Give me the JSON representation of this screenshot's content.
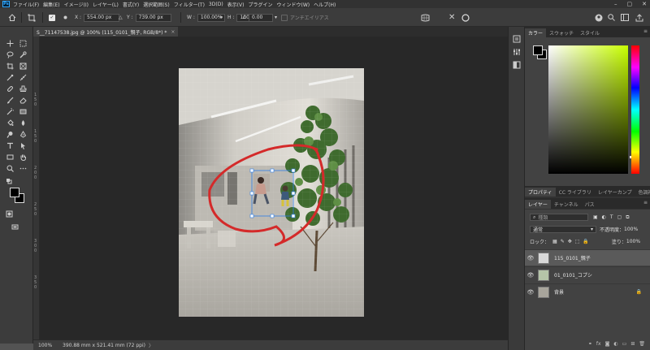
{
  "menubar": {
    "items": [
      "ファイル(F)",
      "編集(E)",
      "イメージ(I)",
      "レイヤー(L)",
      "書式(Y)",
      "選択範囲(S)",
      "フィルター(T)",
      "3D(D)",
      "表示(V)",
      "プラグイン",
      "ウィンドウ(W)",
      "ヘルプ(H)"
    ]
  },
  "options": {
    "x_label": "X :",
    "x_value": "554.00 px",
    "y_label": "Y :",
    "y_value": "739.00 px",
    "w_label": "W :",
    "w_value": "100.00%",
    "h_label": "H :",
    "h_value": "100.00%",
    "angle_value": "0.00",
    "antialias_label": "アンチエイリアス"
  },
  "document": {
    "tab_title": "S__71147538.jpg @ 100% (115_0101_親子, RGB/8*) *",
    "tab_close": "×"
  },
  "ruler": {
    "vertical_ticks": [
      "1",
      "5",
      "0",
      "1",
      "5",
      "0",
      "2",
      "0",
      "0",
      "2",
      "5",
      "0",
      "3",
      "0",
      "0",
      "3",
      "5",
      "0"
    ]
  },
  "status": {
    "zoom": "100%",
    "dimensions": "390.88 mm x 521.41 mm (72 ppi)",
    "arrow": "〉"
  },
  "color_panel": {
    "tabs": [
      "カラー",
      "スウォッチ",
      "スタイル"
    ],
    "fg_color": "#000000",
    "bg_color": "#000000"
  },
  "properties_panel": {
    "tabs": [
      "プロパティ",
      "CC ライブラリ",
      "レイヤーカンプ",
      "色調補正"
    ]
  },
  "layers_panel": {
    "tabs": [
      "レイヤー",
      "チャンネル",
      "パス"
    ],
    "search_placeholder": "種類",
    "blend_mode": "通常",
    "opacity_label": "不透明度：",
    "opacity_value": "100%",
    "lock_label": "ロック：",
    "fill_label": "塗り：",
    "fill_value": "100%",
    "layers": [
      {
        "name": "115_0101_親子",
        "selected": true
      },
      {
        "name": "01_0101_コプシ",
        "selected": false
      },
      {
        "name": "背景",
        "selected": false,
        "locked": true
      }
    ]
  },
  "colors": {
    "accent_red": "#d42a2a",
    "selection_blue": "#2d7ee6"
  }
}
